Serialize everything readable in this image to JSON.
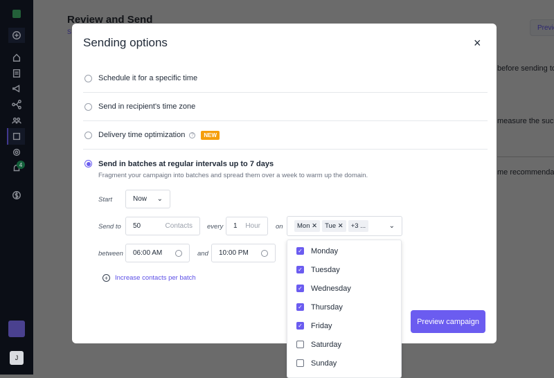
{
  "background": {
    "title": "Review and Send",
    "subtitle": "S",
    "preview_button": "Previe",
    "texts": [
      "before sending to",
      "measure the succ",
      "me recommendat"
    ],
    "avatar_initial": "J",
    "notification_count": "4"
  },
  "modal": {
    "title": "Sending options",
    "close_icon": "×",
    "options": [
      {
        "label": "Schedule it for a specific time",
        "selected": false
      },
      {
        "label": "Send in recipient's time zone",
        "selected": false
      },
      {
        "label": "Delivery time optimization",
        "selected": false,
        "badge": "NEW",
        "help": "?"
      },
      {
        "label": "Send in batches at regular intervals up to 7 days",
        "selected": true
      }
    ],
    "batch_description": "Fragment your campaign into batches and spread them over a week to warm up the domain.",
    "start_label": "Start",
    "start_value": "Now",
    "send_to_label": "Send to",
    "contacts_value": "50",
    "contacts_unit": "Contacts",
    "every_label": "every",
    "every_value": "1",
    "every_unit": "Hour",
    "on_label": "on",
    "day_chips": [
      "Mon",
      "Tue"
    ],
    "more_chip": "+3 ...",
    "between_label": "between",
    "from_time": "06:00 AM",
    "and_label": "and",
    "to_time": "10:00 PM",
    "increase_link": "Increase contacts per batch",
    "preview_button": "Preview campaign"
  },
  "days_dropdown": [
    {
      "label": "Monday",
      "checked": true
    },
    {
      "label": "Tuesday",
      "checked": true
    },
    {
      "label": "Wednesday",
      "checked": true
    },
    {
      "label": "Thursday",
      "checked": true
    },
    {
      "label": "Friday",
      "checked": true
    },
    {
      "label": "Saturday",
      "checked": false
    },
    {
      "label": "Sunday",
      "checked": false
    }
  ],
  "colors": {
    "accent": "#6b5cf0",
    "badge": "#f59e0b",
    "sidebar": "#141a2b"
  }
}
